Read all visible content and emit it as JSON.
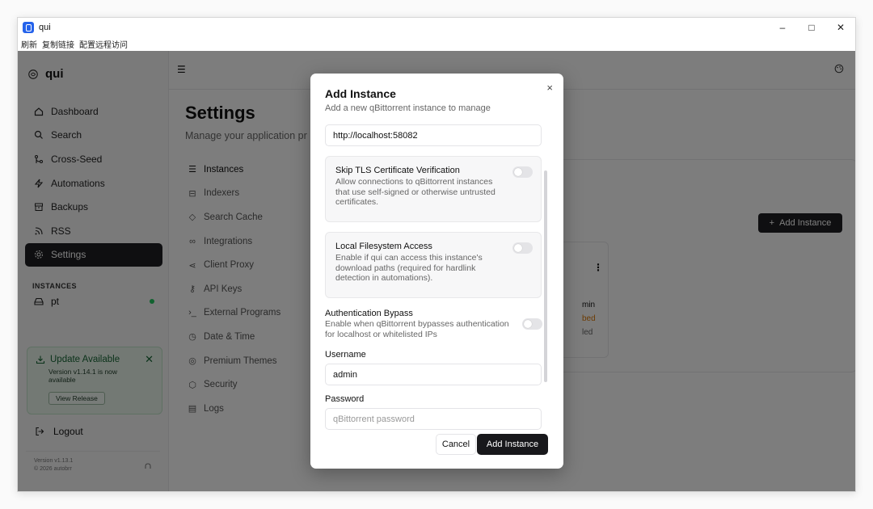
{
  "window": {
    "title": "qui",
    "minimize": "–",
    "maximize": "□",
    "close": "✕"
  },
  "menubar": [
    "刷新",
    "复制链接",
    "配置远程访问"
  ],
  "sidebar": {
    "logo": "qui",
    "items": [
      {
        "label": "Dashboard",
        "icon": "home-icon"
      },
      {
        "label": "Search",
        "icon": "search-icon"
      },
      {
        "label": "Cross-Seed",
        "icon": "git-merge-icon"
      },
      {
        "label": "Automations",
        "icon": "zap-icon"
      },
      {
        "label": "Backups",
        "icon": "archive-icon"
      },
      {
        "label": "RSS",
        "icon": "rss-icon"
      },
      {
        "label": "Settings",
        "icon": "gear-icon",
        "active": true
      }
    ],
    "instances_label": "INSTANCES",
    "instance": "pt",
    "update": {
      "title": "Update Available",
      "text": "Version v1.14.1 is now available",
      "button": "View Release"
    },
    "logout": "Logout",
    "version_line1": "Version v1.13.1",
    "version_line2": "© 2026 autobrr"
  },
  "main": {
    "title": "Settings",
    "subtitle": "Manage your application pr",
    "settings_nav": [
      {
        "label": "Instances",
        "icon": "server-icon"
      },
      {
        "label": "Indexers",
        "icon": "database-icon"
      },
      {
        "label": "Search Cache",
        "icon": "layers-icon"
      },
      {
        "label": "Integrations",
        "icon": "link-icon"
      },
      {
        "label": "Client Proxy",
        "icon": "share-icon"
      },
      {
        "label": "API Keys",
        "icon": "key-icon"
      },
      {
        "label": "External Programs",
        "icon": "terminal-icon"
      },
      {
        "label": "Date & Time",
        "icon": "clock-icon"
      },
      {
        "label": "Premium Themes",
        "icon": "palette-icon"
      },
      {
        "label": "Security",
        "icon": "shield-icon"
      },
      {
        "label": "Logs",
        "icon": "file-icon"
      }
    ],
    "add_instance_button": "Add Instance",
    "instance_card": {
      "line1": "min",
      "line2": "bed",
      "line3": "led"
    }
  },
  "modal": {
    "title": "Add Instance",
    "subtitle": "Add a new qBittorrent instance to manage",
    "url_value": "http://localhost:58082",
    "skip_tls": {
      "title": "Skip TLS Certificate Verification",
      "desc": "Allow connections to qBittorrent instances that use self-signed or otherwise untrusted certificates."
    },
    "local_fs": {
      "title": "Local Filesystem Access",
      "desc": "Enable if qui can access this instance's download paths (required for hardlink detection in automations)."
    },
    "bypass": {
      "title": "Authentication Bypass",
      "desc": "Enable when qBittorrent bypasses authentication for localhost or whitelisted IPs"
    },
    "username_label": "Username",
    "username_value": "admin",
    "password_label": "Password",
    "password_placeholder": "qBittorrent password",
    "cancel": "Cancel",
    "submit": "Add Instance",
    "close": "×"
  }
}
